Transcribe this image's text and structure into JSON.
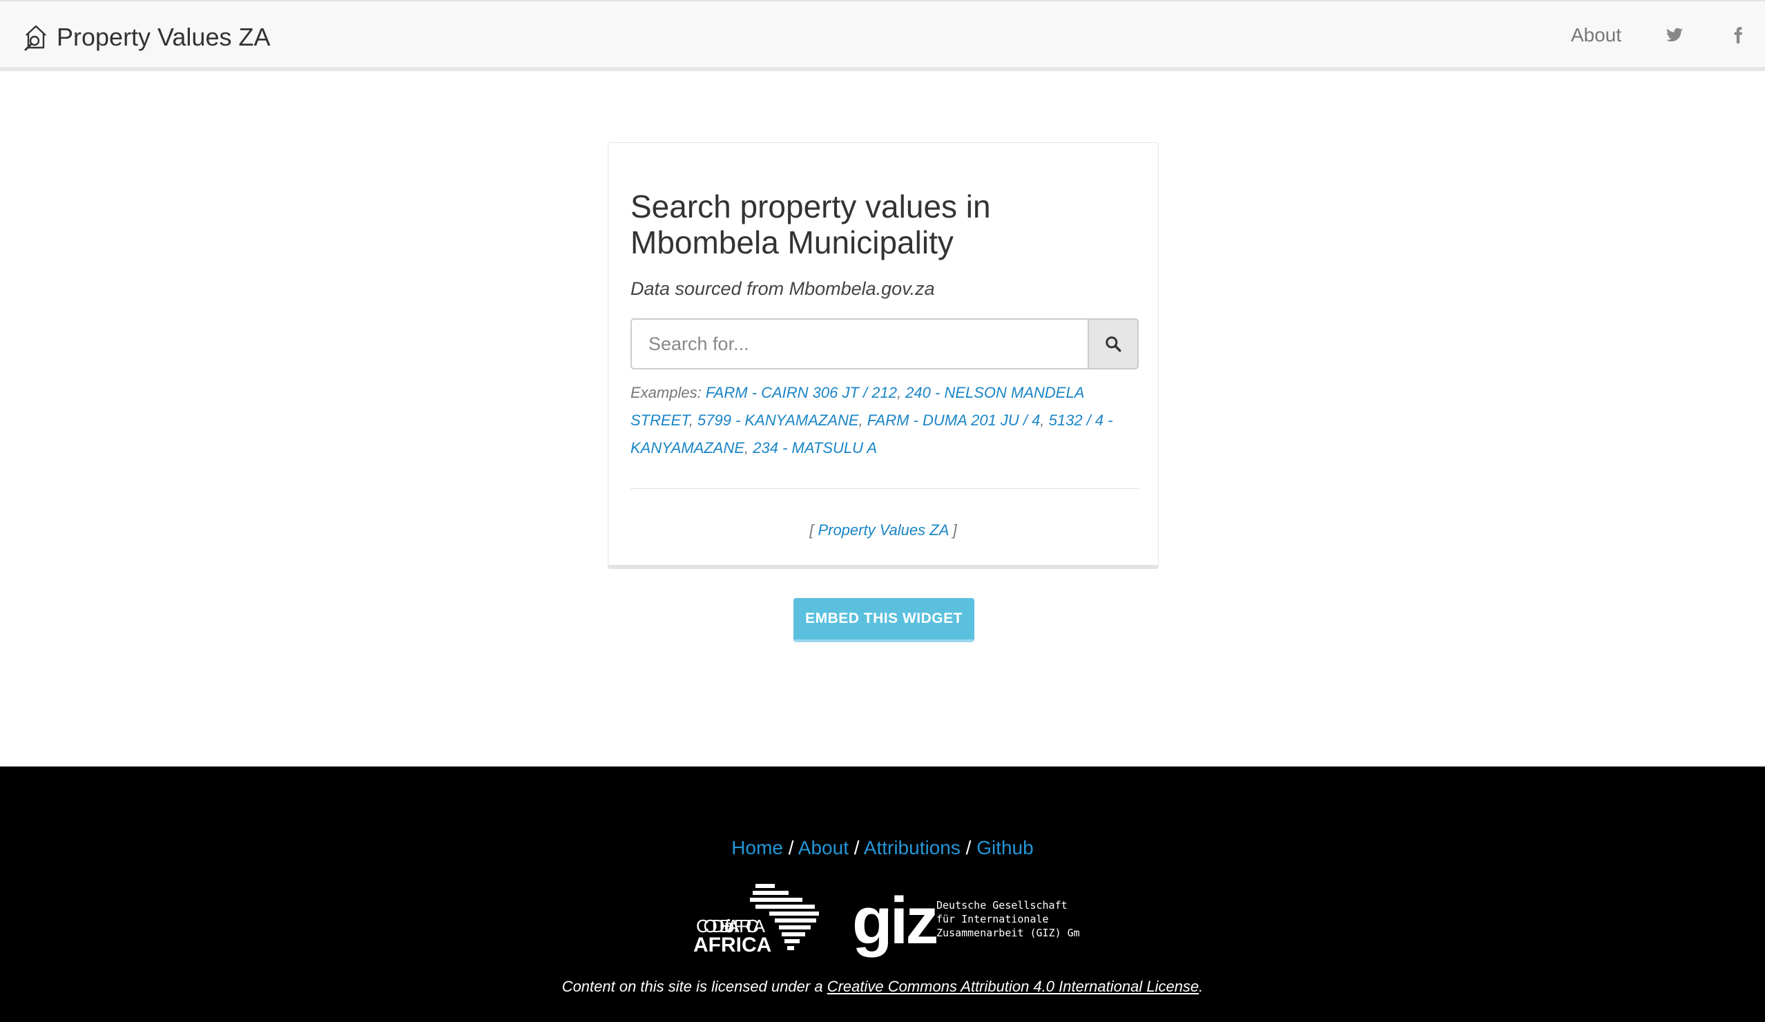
{
  "navbar": {
    "brand": "Property Values ZA",
    "about": "About",
    "twitter_icon": "twitter-icon",
    "facebook_icon": "facebook-icon"
  },
  "card": {
    "title": "Search property values in Mbombela Municipality",
    "subtitle": "Data sourced from Mbombela.gov.za",
    "search": {
      "placeholder": "Search for...",
      "value": ""
    },
    "examples_label": "Examples:",
    "examples": [
      "FARM - CAIRN 306 JT / 212",
      "240 - NELSON MANDELA STREET",
      "5799 - KANYAMAZANE",
      "FARM - DUMA 201 JU / 4",
      "5132 / 4 - KANYAMAZANE",
      "234 - MATSULU A"
    ],
    "footer_link": "Property Values ZA"
  },
  "embed_button": "EMBED THIS WIDGET",
  "footer": {
    "links": [
      "Home",
      "About",
      "Attributions",
      "Github"
    ],
    "logo1": "CODE for AFRICA",
    "logo2": {
      "mark": "giz",
      "line1": "Deutsche Gesellschaft",
      "line2": "für Internationale",
      "line3": "Zusammenarbeit (GIZ) GmbH"
    },
    "license_prefix": "Content on this site is licensed under a",
    "license_link": "Creative Commons Attribution 4.0 International License"
  },
  "colors": {
    "link": "#1a85c6",
    "embed": "#5bc0de",
    "footer_bg": "#000000"
  }
}
